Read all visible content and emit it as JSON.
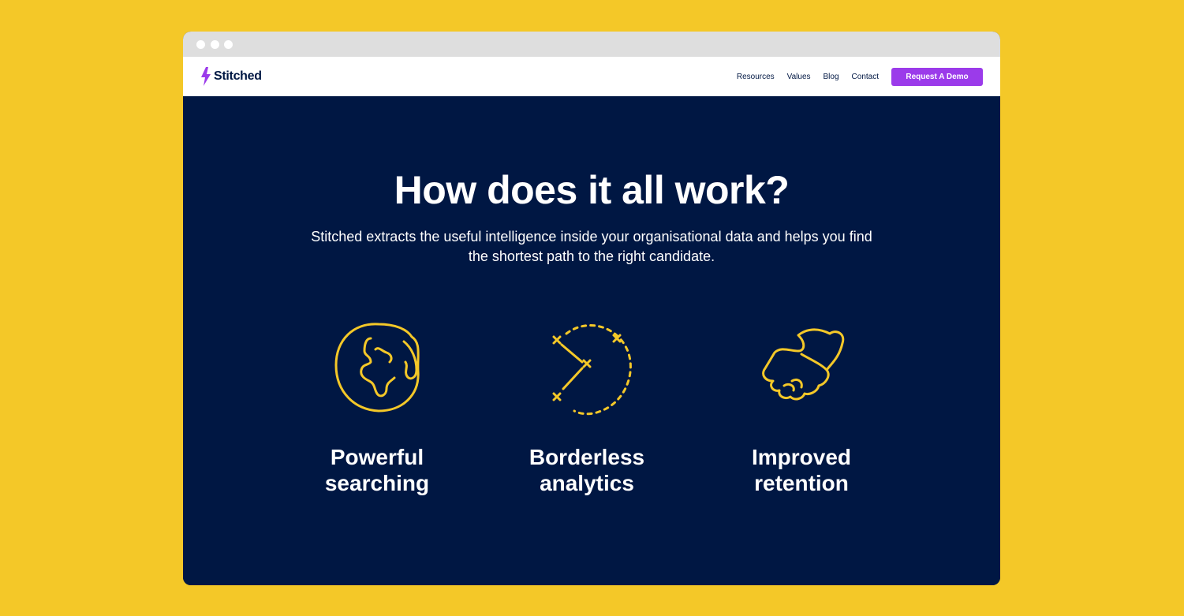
{
  "brand": {
    "name": "Stitched",
    "accent": "#9B3BEA"
  },
  "colors": {
    "background": "#F4C828",
    "hero": "#001743",
    "icon_stroke": "#F4C828"
  },
  "nav": {
    "links": [
      "Resources",
      "Values",
      "Blog",
      "Contact"
    ],
    "cta_label": "Request A Demo"
  },
  "hero": {
    "title": "How does it all work?",
    "subtitle": "Stitched extracts the useful intelligence inside your organisational data and helps you find the shortest path to the right candidate."
  },
  "features": [
    {
      "icon": "globe-icon",
      "line1": "Powerful",
      "line2": "searching"
    },
    {
      "icon": "strategy-path-icon",
      "line1": "Borderless",
      "line2": "analytics"
    },
    {
      "icon": "handshake-icon",
      "line1": "Improved",
      "line2": "retention"
    }
  ]
}
